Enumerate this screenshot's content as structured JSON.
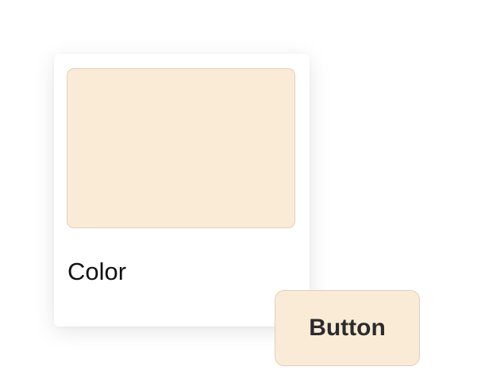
{
  "card": {
    "label": "Color",
    "swatch_color": "#faebd7"
  },
  "button": {
    "label": "Button",
    "background": "#faebd7"
  },
  "colors": {
    "border": "#e3cfb8",
    "text": "#2b2b2b"
  }
}
